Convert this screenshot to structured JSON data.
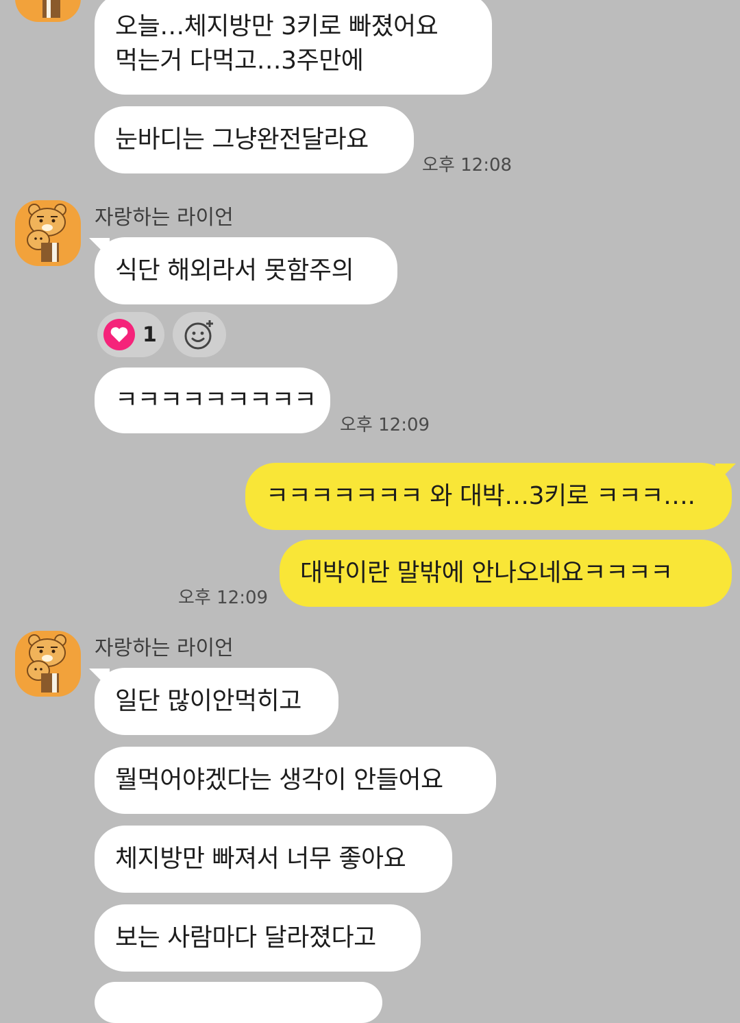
{
  "colors": {
    "background": "#bcbcbc",
    "incoming_bubble": "#ffffff",
    "outgoing_bubble": "#f9e637",
    "heart": "#f5237a"
  },
  "messages": {
    "m1": "오늘…체지방만 3키로 빠졌어요\n먹는거 다먹고…3주만에",
    "m2": "눈바디는 그냥완전달라요",
    "t1": "오후 12:08",
    "sender2": "자랑하는 라이언",
    "m3": "식단 해외라서 못함주의",
    "reaction_count": "1",
    "m4": "ㅋㅋㅋㅋㅋㅋㅋㅋㅋ",
    "t2": "오후 12:09",
    "me1": "ㅋㅋㅋㅋㅋㅋㅋ 와 대박…3키로 ㅋㅋㅋ….",
    "me2": "대박이란 말밖에 안나오네요ㅋㅋㅋㅋ",
    "t3": "오후 12:09",
    "sender3": "자랑하는 라이언",
    "m5": "일단 많이안먹히고",
    "m6": "뭘먹어야겠다는 생각이 안들어요",
    "m7": "체지방만 빠져서 너무 좋아요",
    "m8": "보는 사람마다 달라졌다고"
  },
  "icons": {
    "avatar": "ryan-character-avatar-icon",
    "reaction": "heart-icon",
    "add_reaction": "smiley-plus-icon"
  }
}
